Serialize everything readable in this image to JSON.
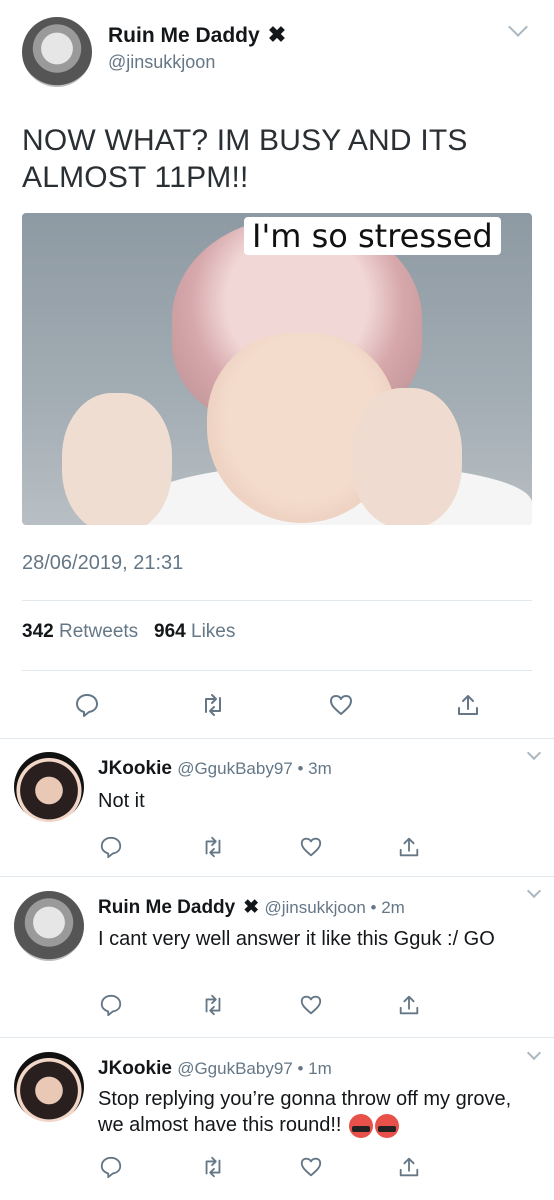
{
  "main_tweet": {
    "author_name": "Ruin Me Daddy",
    "author_mark": "✖",
    "handle": "@jinsukkjoon",
    "text": "NOW WHAT? IM BUSY AND ITS ALMOST 11PM!!",
    "image_caption": "I'm so stressed",
    "timestamp": "28/06/2019, 21:31",
    "retweets_count": "342",
    "retweets_label": "Retweets",
    "likes_count": "964",
    "likes_label": "Likes"
  },
  "replies": [
    {
      "author_name": "JKookie",
      "handle": "@GgukBaby97",
      "time": "• 3m",
      "text": "Not it"
    },
    {
      "author_name": "Ruin Me Daddy",
      "author_mark": "✖",
      "handle": "@jinsukkjoon",
      "time": "• 2m",
      "text": "I cant very well answer it like this Gguk :/ GO"
    },
    {
      "author_name": "JKookie",
      "handle": "@GgukBaby97",
      "time": "• 1m",
      "text": "Stop replying you’re gonna throw off my grove, we almost have this round!!"
    }
  ],
  "icons": {
    "reply": "reply-icon",
    "retweet": "retweet-icon",
    "like": "heart-icon",
    "share": "share-icon",
    "menu": "chevron-down-icon"
  },
  "colors": {
    "name": "#14171a",
    "handle": "#657786",
    "icon": "#657786",
    "divider": "#e1e8ed"
  }
}
